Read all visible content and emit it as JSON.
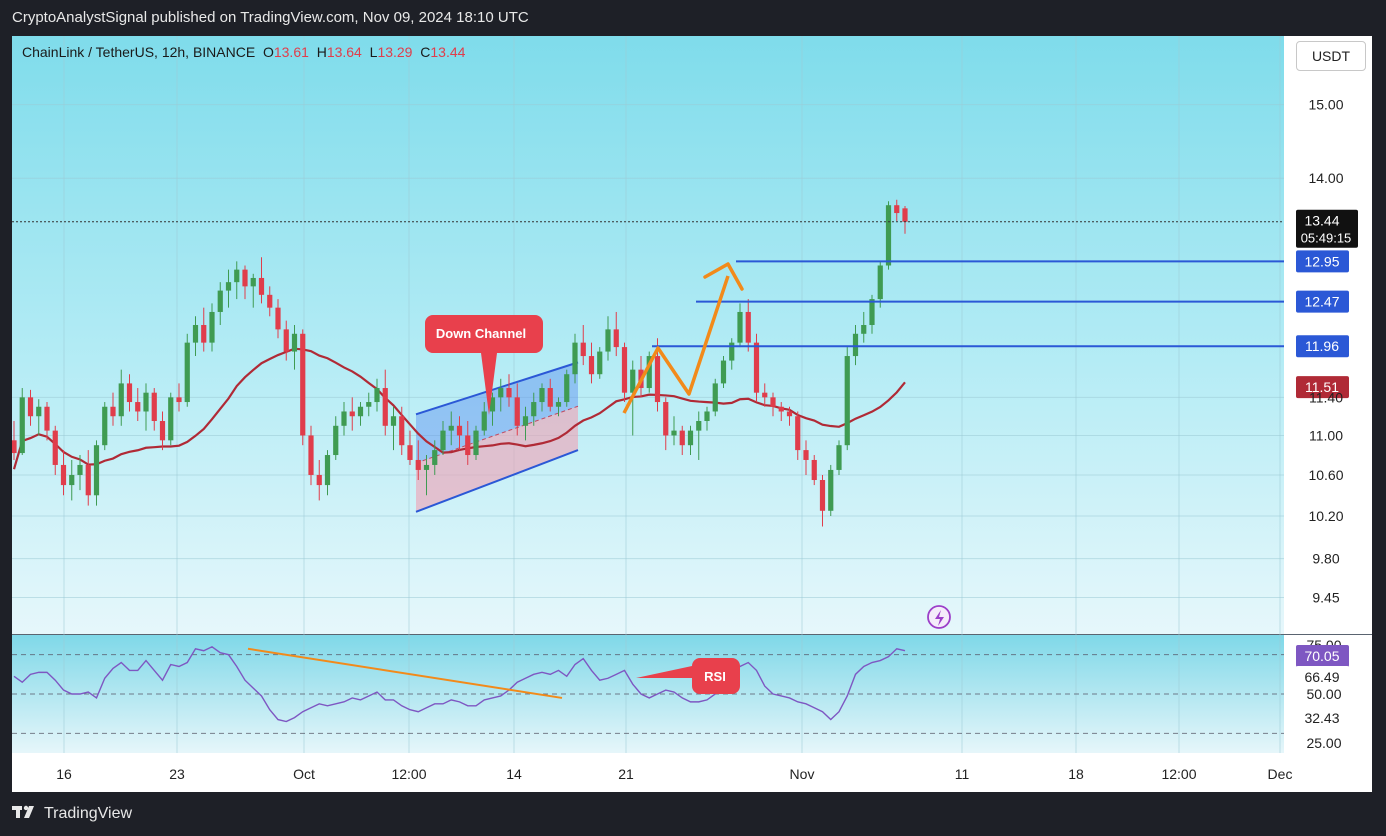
{
  "header": {
    "attribution": "CryptoAnalystSignal published on TradingView.com, Nov 09, 2024 18:10 UTC"
  },
  "legend": {
    "symbol": "ChainLink / TetherUS, 12h, BINANCE",
    "o_label": "O",
    "o_value": "13.61",
    "h_label": "H",
    "h_value": "13.64",
    "l_label": "L",
    "l_value": "13.29",
    "c_label": "C",
    "c_value": "13.44"
  },
  "currency_button": "USDT",
  "footer": {
    "brand": "TradingView"
  },
  "colors": {
    "chart_bg_top": "#7fdceb",
    "chart_bg_bottom": "#e6f7fb",
    "up_candle": "#3f9b52",
    "down_candle": "#e03d4b",
    "ma_line": "#b02a36",
    "level_line": "#2b58d6",
    "annotation_red": "#e8404c",
    "arrow_orange": "#f28a1a",
    "rsi_line": "#7e57c2"
  },
  "chart_data": [
    {
      "type": "candlestick",
      "title": "ChainLink / TetherUS, 12h, BINANCE",
      "ylim": [
        9.1,
        15.6
      ],
      "y_ticks": [
        "15.00",
        "14.00",
        "11.00",
        "10.60",
        "10.20",
        "9.80",
        "9.45",
        "11.40"
      ],
      "x_ticks": [
        "16",
        "23",
        "Oct",
        "12:00",
        "14",
        "21",
        "Nov",
        "11",
        "18",
        "12:00",
        "Dec"
      ],
      "grid": true,
      "last_price": {
        "value": "13.44",
        "countdown": "05:49:15"
      },
      "levels": [
        {
          "value": "12.95",
          "color": "#2b58d6"
        },
        {
          "value": "12.47",
          "color": "#2b58d6"
        },
        {
          "value": "11.96",
          "color": "#2b58d6"
        }
      ],
      "moving_average": {
        "last_value": "11.51"
      },
      "annotations": [
        "Down Channel"
      ],
      "ohlc_series": [
        [
          10.95,
          11.15,
          10.75,
          10.82
        ],
        [
          10.82,
          11.5,
          10.8,
          11.4
        ],
        [
          11.4,
          11.48,
          11.1,
          11.2
        ],
        [
          11.2,
          11.38,
          11.0,
          11.3
        ],
        [
          11.3,
          11.35,
          10.95,
          11.05
        ],
        [
          11.05,
          11.1,
          10.6,
          10.7
        ],
        [
          10.7,
          10.85,
          10.4,
          10.5
        ],
        [
          10.5,
          10.75,
          10.35,
          10.6
        ],
        [
          10.6,
          10.8,
          10.45,
          10.7
        ],
        [
          10.7,
          10.85,
          10.3,
          10.4
        ],
        [
          10.4,
          10.95,
          10.3,
          10.9
        ],
        [
          10.9,
          11.35,
          10.85,
          11.3
        ],
        [
          11.3,
          11.45,
          11.1,
          11.2
        ],
        [
          11.2,
          11.7,
          11.1,
          11.55
        ],
        [
          11.55,
          11.65,
          11.25,
          11.35
        ],
        [
          11.35,
          11.5,
          11.15,
          11.25
        ],
        [
          11.25,
          11.55,
          11.05,
          11.45
        ],
        [
          11.45,
          11.5,
          11.05,
          11.15
        ],
        [
          11.15,
          11.25,
          10.85,
          10.95
        ],
        [
          10.95,
          11.45,
          10.9,
          11.4
        ],
        [
          11.4,
          11.55,
          11.25,
          11.35
        ],
        [
          11.35,
          12.1,
          11.3,
          12.0
        ],
        [
          12.0,
          12.3,
          11.85,
          12.2
        ],
        [
          12.2,
          12.4,
          11.9,
          12.0
        ],
        [
          12.0,
          12.45,
          11.9,
          12.35
        ],
        [
          12.35,
          12.7,
          12.2,
          12.6
        ],
        [
          12.6,
          12.85,
          12.4,
          12.7
        ],
        [
          12.7,
          12.95,
          12.5,
          12.85
        ],
        [
          12.85,
          12.9,
          12.5,
          12.65
        ],
        [
          12.65,
          12.8,
          12.4,
          12.75
        ],
        [
          12.75,
          13.0,
          12.45,
          12.55
        ],
        [
          12.55,
          12.65,
          12.3,
          12.4
        ],
        [
          12.4,
          12.5,
          12.05,
          12.15
        ],
        [
          12.15,
          12.25,
          11.8,
          11.9
        ],
        [
          11.9,
          12.2,
          11.7,
          12.1
        ],
        [
          12.1,
          12.15,
          10.9,
          11.0
        ],
        [
          11.0,
          11.1,
          10.5,
          10.6
        ],
        [
          10.6,
          10.75,
          10.35,
          10.5
        ],
        [
          10.5,
          10.85,
          10.4,
          10.8
        ],
        [
          10.8,
          11.2,
          10.75,
          11.1
        ],
        [
          11.1,
          11.35,
          11.0,
          11.25
        ],
        [
          11.25,
          11.4,
          11.05,
          11.2
        ],
        [
          11.2,
          11.35,
          11.1,
          11.3
        ],
        [
          11.3,
          11.45,
          11.2,
          11.35
        ],
        [
          11.35,
          11.6,
          11.25,
          11.5
        ],
        [
          11.5,
          11.7,
          11.0,
          11.1
        ],
        [
          11.1,
          11.3,
          10.85,
          11.2
        ],
        [
          11.2,
          11.3,
          10.8,
          10.9
        ],
        [
          10.9,
          11.05,
          10.7,
          10.75
        ],
        [
          10.75,
          10.95,
          10.55,
          10.65
        ],
        [
          10.65,
          10.8,
          10.4,
          10.7
        ],
        [
          10.7,
          10.95,
          10.6,
          10.85
        ],
        [
          10.85,
          11.15,
          10.8,
          11.05
        ],
        [
          11.05,
          11.25,
          10.9,
          11.1
        ],
        [
          11.1,
          11.2,
          10.85,
          11.0
        ],
        [
          11.0,
          11.15,
          10.7,
          10.8
        ],
        [
          10.8,
          11.1,
          10.75,
          11.05
        ],
        [
          11.05,
          11.35,
          11.0,
          11.25
        ],
        [
          11.25,
          11.45,
          11.1,
          11.4
        ],
        [
          11.4,
          11.6,
          11.25,
          11.5
        ],
        [
          11.5,
          11.65,
          11.3,
          11.4
        ],
        [
          11.4,
          11.55,
          11.0,
          11.1
        ],
        [
          11.1,
          11.3,
          10.95,
          11.2
        ],
        [
          11.2,
          11.45,
          11.1,
          11.35
        ],
        [
          11.35,
          11.55,
          11.25,
          11.5
        ],
        [
          11.5,
          11.6,
          11.25,
          11.3
        ],
        [
          11.3,
          11.4,
          11.2,
          11.35
        ],
        [
          11.35,
          11.7,
          11.3,
          11.65
        ],
        [
          11.65,
          12.1,
          11.55,
          12.0
        ],
        [
          12.0,
          12.2,
          11.75,
          11.85
        ],
        [
          11.85,
          12.0,
          11.55,
          11.65
        ],
        [
          11.65,
          11.95,
          11.6,
          11.9
        ],
        [
          11.9,
          12.3,
          11.8,
          12.15
        ],
        [
          12.15,
          12.35,
          11.85,
          11.95
        ],
        [
          11.95,
          12.0,
          11.35,
          11.45
        ],
        [
          11.45,
          11.8,
          11.0,
          11.7
        ],
        [
          11.7,
          11.85,
          11.4,
          11.5
        ],
        [
          11.5,
          11.9,
          11.45,
          11.85
        ],
        [
          11.85,
          12.05,
          11.25,
          11.35
        ],
        [
          11.35,
          11.4,
          10.85,
          11.0
        ],
        [
          11.0,
          11.2,
          10.9,
          11.05
        ],
        [
          11.05,
          11.1,
          10.8,
          10.9
        ],
        [
          10.9,
          11.1,
          10.8,
          11.05
        ],
        [
          11.05,
          11.25,
          10.75,
          11.15
        ],
        [
          11.15,
          11.3,
          11.05,
          11.25
        ],
        [
          11.25,
          11.6,
          11.2,
          11.55
        ],
        [
          11.55,
          11.85,
          11.5,
          11.8
        ],
        [
          11.8,
          12.05,
          11.7,
          12.0
        ],
        [
          12.0,
          12.45,
          11.95,
          12.35
        ],
        [
          12.35,
          12.5,
          11.9,
          12.0
        ],
        [
          12.0,
          12.1,
          11.35,
          11.45
        ],
        [
          11.45,
          11.55,
          11.3,
          11.4
        ],
        [
          11.4,
          11.45,
          11.2,
          11.3
        ],
        [
          11.3,
          11.35,
          11.15,
          11.25
        ],
        [
          11.25,
          11.3,
          11.1,
          11.2
        ],
        [
          11.2,
          11.25,
          10.75,
          10.85
        ],
        [
          10.85,
          10.95,
          10.6,
          10.75
        ],
        [
          10.75,
          10.8,
          10.5,
          10.55
        ],
        [
          10.55,
          10.6,
          10.1,
          10.25
        ],
        [
          10.25,
          10.7,
          10.2,
          10.65
        ],
        [
          10.65,
          10.95,
          10.6,
          10.9
        ],
        [
          10.9,
          11.95,
          10.85,
          11.85
        ],
        [
          11.85,
          12.2,
          11.75,
          12.1
        ],
        [
          12.1,
          12.35,
          12.0,
          12.2
        ],
        [
          12.2,
          12.55,
          12.1,
          12.5
        ],
        [
          12.5,
          12.95,
          12.4,
          12.9
        ],
        [
          12.9,
          13.7,
          12.85,
          13.65
        ],
        [
          13.65,
          13.72,
          13.45,
          13.55
        ],
        [
          13.61,
          13.64,
          13.29,
          13.44
        ]
      ]
    },
    {
      "type": "line",
      "name": "RSI",
      "ylim": [
        20,
        80
      ],
      "y_ticks": [
        "75.00",
        "50.00",
        "25.00"
      ],
      "values_shown": [
        "70.05",
        "66.49",
        "32.43"
      ],
      "dashed_levels": [
        70,
        50,
        30
      ],
      "values": [
        59,
        56,
        60,
        61,
        61,
        57,
        52,
        50,
        50,
        51,
        48,
        58,
        63,
        66,
        62,
        62,
        67,
        62,
        57,
        65,
        64,
        66,
        73,
        72,
        74,
        71,
        70,
        64,
        57,
        53,
        49,
        42,
        37,
        36,
        38,
        41,
        43,
        45,
        44,
        45,
        46,
        48,
        47,
        49,
        51,
        47,
        47,
        44,
        42,
        41,
        43,
        45,
        45,
        47,
        46,
        44,
        44,
        47,
        48,
        49,
        52,
        56,
        58,
        60,
        61,
        60,
        62,
        59,
        65,
        68,
        62,
        57,
        58,
        60,
        62,
        55,
        50,
        48,
        50,
        52,
        51,
        48,
        46,
        46,
        47,
        50,
        55,
        60,
        64,
        66,
        62,
        54,
        50,
        49,
        48,
        46,
        45,
        43,
        41,
        37,
        41,
        49,
        60,
        64,
        66,
        67,
        69,
        73,
        72
      ]
    }
  ]
}
